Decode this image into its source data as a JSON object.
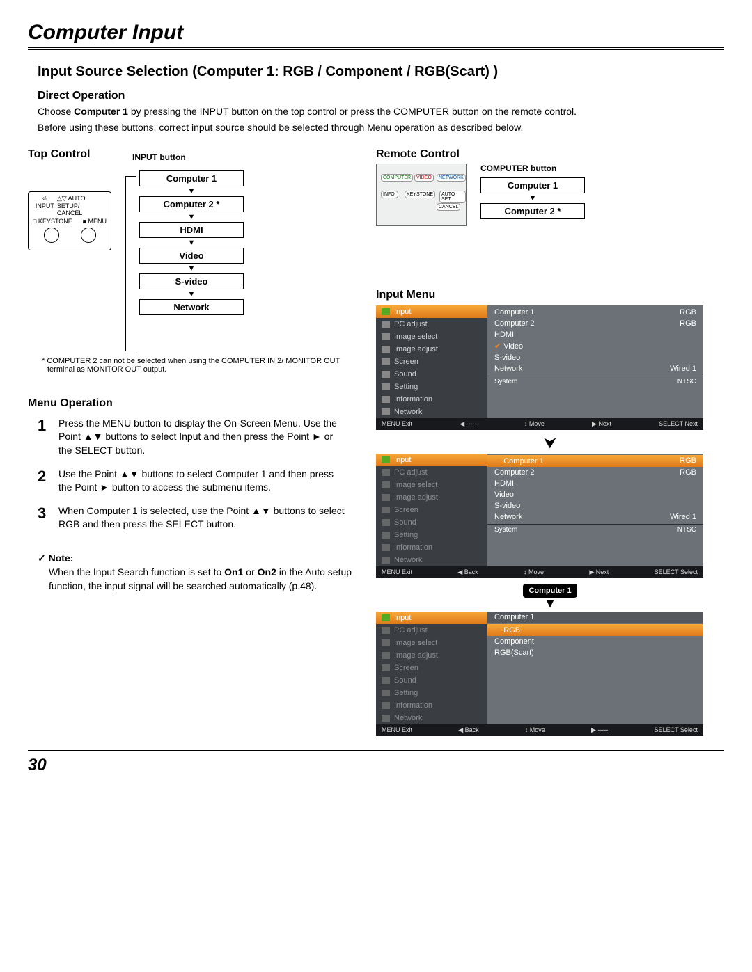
{
  "page": {
    "title": "Computer Input",
    "number": "30"
  },
  "section_title": "Input Source Selection (Computer 1: RGB / Component / RGB(Scart) )",
  "direct_op": {
    "heading": "Direct Operation",
    "p1_a": "Choose ",
    "p1_b": "Computer 1",
    "p1_c": " by pressing the INPUT button on the top control or press the COMPUTER button on the remote control.",
    "p2": "Before using these buttons, correct input source should be selected through Menu operation as described below."
  },
  "top_control": {
    "heading": "Top Control",
    "input_label": "INPUT button",
    "pad": {
      "r1a": "⏎ INPUT",
      "r1b": "△▽ AUTO SETUP/\nCANCEL",
      "r2a": "□ KEYSTONE",
      "r2b": "■ MENU"
    },
    "flow": [
      "Computer 1",
      "Computer 2 *",
      "HDMI",
      "Video",
      "S-video",
      "Network"
    ]
  },
  "footnote": "* COMPUTER 2 can not be selected when using the COMPUTER IN 2/ MONITOR OUT terminal as MONITOR OUT output.",
  "remote": {
    "heading": "Remote Control",
    "btn_label": "COMPUTER button",
    "flow": [
      "Computer 1",
      "Computer 2 *"
    ],
    "keys": [
      "COMPUTER",
      "VIDEO",
      "NETWORK",
      "INFO.",
      "KEYSTONE",
      "AUTO SET",
      "CANCEL"
    ]
  },
  "menu_op": {
    "heading": "Menu Operation",
    "steps": [
      "Press the MENU button to display the On-Screen Menu. Use the Point ▲▼ buttons to select Input and then press the Point ► or the SELECT button.",
      "Use the Point ▲▼ buttons to select Computer 1 and then press the Point ► button to access the submenu items.",
      "When Computer 1 is selected, use the Point ▲▼ buttons to select RGB and then press the SELECT button."
    ],
    "bold": {
      "s1": "Input",
      "s2": "Computer 1",
      "s3a": "Computer 1",
      "s3b": "RGB"
    }
  },
  "input_menu_heading": "Input Menu",
  "osd_left_items": [
    "Input",
    "PC adjust",
    "Image select",
    "Image adjust",
    "Screen",
    "Sound",
    "Setting",
    "Information",
    "Network"
  ],
  "osd1": {
    "right": [
      {
        "l": "Computer 1",
        "r": "RGB"
      },
      {
        "l": "Computer 2",
        "r": "RGB"
      },
      {
        "l": "HDMI",
        "r": ""
      },
      {
        "l": "Video",
        "r": "",
        "chk": true
      },
      {
        "l": "S-video",
        "r": ""
      },
      {
        "l": "Network",
        "r": "Wired 1"
      }
    ],
    "sys": {
      "l": "System",
      "r": "NTSC"
    },
    "bar": [
      "MENU Exit",
      "◀ -----",
      "↕ Move",
      "▶ Next",
      "SELECT Next"
    ]
  },
  "osd2": {
    "sel_idx": 0,
    "right": [
      {
        "l": "Computer 1",
        "r": "RGB",
        "chk": true,
        "sel": true
      },
      {
        "l": "Computer 2",
        "r": "RGB"
      },
      {
        "l": "HDMI",
        "r": ""
      },
      {
        "l": "Video",
        "r": ""
      },
      {
        "l": "S-video",
        "r": ""
      },
      {
        "l": "Network",
        "r": "Wired 1"
      }
    ],
    "sys": {
      "l": "System",
      "r": "NTSC"
    },
    "bar": [
      "MENU Exit",
      "◀ Back",
      "↕ Move",
      "▶ Next",
      "SELECT Select"
    ],
    "arrow_label": "Computer 1"
  },
  "osd3": {
    "header": "Computer 1",
    "right": [
      {
        "l": "RGB",
        "chk": true,
        "sel": true
      },
      {
        "l": "Component"
      },
      {
        "l": "RGB(Scart)"
      }
    ],
    "bar": [
      "MENU Exit",
      "◀ Back",
      "↕ Move",
      "▶ -----",
      "SELECT Select"
    ]
  },
  "note": {
    "heading": "Note:",
    "body_a": "When the Input Search function is set to ",
    "b1": "On1",
    "mid": " or ",
    "b2": "On2",
    "body_b": " in the Auto setup function, the input signal will be searched automatically (p.48)."
  }
}
